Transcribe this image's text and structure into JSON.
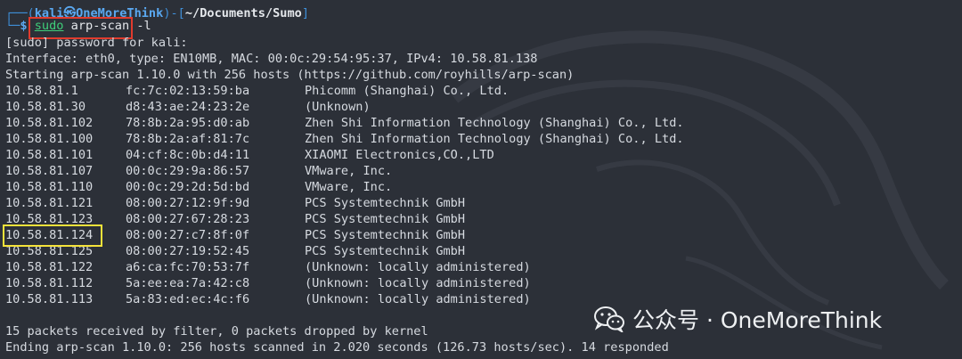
{
  "prompt": {
    "user": "kali",
    "at": "㉿",
    "host": "OneMoreThink",
    "path": "~/Documents/Sumo",
    "symbol": "$",
    "cmd_sudo": "sudo",
    "cmd_rest": " arp-scan -l"
  },
  "header_lines": [
    "[sudo] password for kali:",
    "Interface: eth0, type: EN10MB, MAC: 00:0c:29:54:95:37, IPv4: 10.58.81.138",
    "Starting arp-scan 1.10.0 with 256 hosts (https://github.com/royhills/arp-scan)"
  ],
  "results": [
    {
      "ip": "10.58.81.1",
      "mac": "fc:7c:02:13:59:ba",
      "vendor": "Phicomm (Shanghai) Co., Ltd."
    },
    {
      "ip": "10.58.81.30",
      "mac": "d8:43:ae:24:23:2e",
      "vendor": "(Unknown)"
    },
    {
      "ip": "10.58.81.102",
      "mac": "78:8b:2a:95:d0:ab",
      "vendor": "Zhen Shi Information Technology (Shanghai) Co., Ltd."
    },
    {
      "ip": "10.58.81.100",
      "mac": "78:8b:2a:af:81:7c",
      "vendor": "Zhen Shi Information Technology (Shanghai) Co., Ltd."
    },
    {
      "ip": "10.58.81.101",
      "mac": "04:cf:8c:0b:d4:11",
      "vendor": "XIAOMI Electronics,CO.,LTD"
    },
    {
      "ip": "10.58.81.107",
      "mac": "00:0c:29:9a:86:57",
      "vendor": "VMware, Inc."
    },
    {
      "ip": "10.58.81.110",
      "mac": "00:0c:29:2d:5d:bd",
      "vendor": "VMware, Inc."
    },
    {
      "ip": "10.58.81.121",
      "mac": "08:00:27:12:9f:9d",
      "vendor": "PCS Systemtechnik GmbH"
    },
    {
      "ip": "10.58.81.123",
      "mac": "08:00:27:67:28:23",
      "vendor": "PCS Systemtechnik GmbH"
    },
    {
      "ip": "10.58.81.124",
      "mac": "08:00:27:c7:8f:0f",
      "vendor": "PCS Systemtechnik GmbH"
    },
    {
      "ip": "10.58.81.125",
      "mac": "08:00:27:19:52:45",
      "vendor": "PCS Systemtechnik GmbH"
    },
    {
      "ip": "10.58.81.122",
      "mac": "a6:ca:fc:70:53:7f",
      "vendor": "(Unknown: locally administered)"
    },
    {
      "ip": "10.58.81.112",
      "mac": "5a:ee:ea:7a:42:c8",
      "vendor": "(Unknown: locally administered)"
    },
    {
      "ip": "10.58.81.113",
      "mac": "5a:83:ed:ec:4c:f6",
      "vendor": "(Unknown: locally administered)"
    }
  ],
  "footer_lines": [
    "15 packets received by filter, 0 packets dropped by kernel",
    "Ending arp-scan 1.10.0: 256 hosts scanned in 2.020 seconds (126.73 hosts/sec). 14 responded"
  ],
  "watermark": {
    "icon": "wechat-icon",
    "text": "公众号 · OneMoreThink"
  },
  "colors": {
    "background": "#2c3038",
    "prompt_blue": "#3f8fd8",
    "command_green": "#3fcf7a",
    "highlight_red": "#e03b2d",
    "highlight_yellow": "#f4e23a"
  }
}
